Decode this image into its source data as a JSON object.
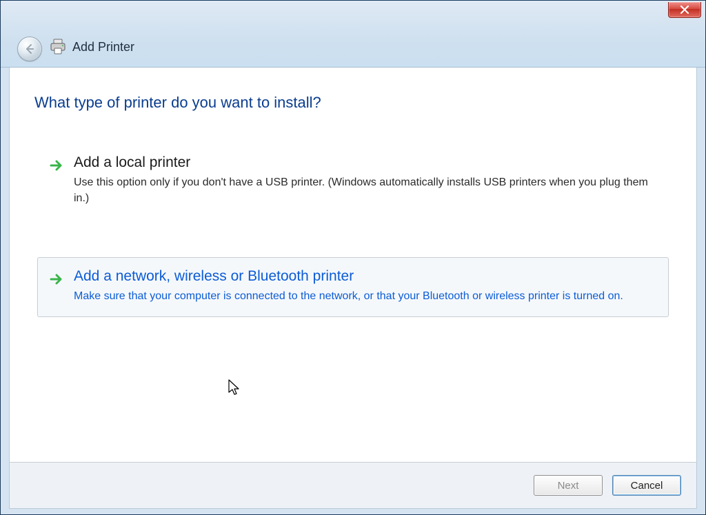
{
  "window": {
    "title": "Add Printer"
  },
  "heading": "What type of printer do you want to install?",
  "options": [
    {
      "title": "Add a local printer",
      "desc": "Use this option only if you don't have a USB printer. (Windows automatically installs USB printers when you plug them in.)"
    },
    {
      "title": "Add a network, wireless or Bluetooth printer",
      "desc": "Make sure that your computer is connected to the network, or that your Bluetooth or wireless printer is turned on."
    }
  ],
  "buttons": {
    "next": "Next",
    "cancel": "Cancel"
  },
  "colors": {
    "link": "#0b5cd6",
    "heading": "#0a3d8f",
    "arrow": "#39b54a"
  }
}
